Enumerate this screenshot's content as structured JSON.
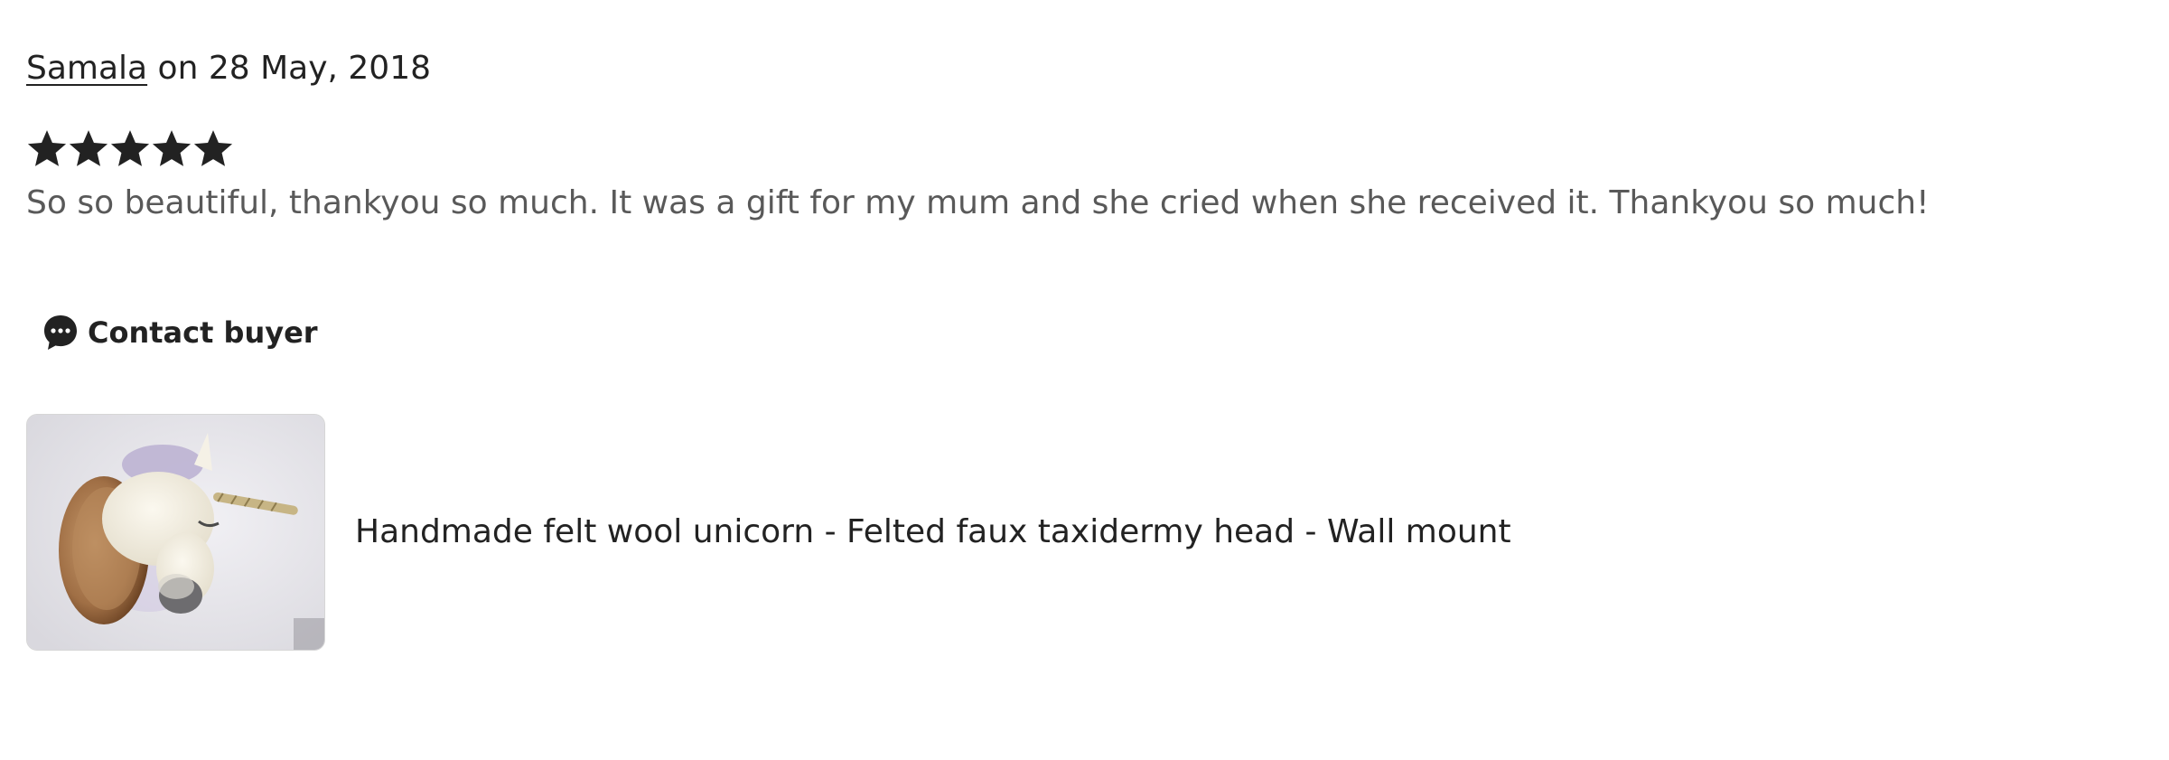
{
  "review": {
    "reviewer_name": "Samala",
    "date_text": " on 28 May, 2018",
    "rating": 5,
    "rating_max": 5,
    "text": "So so beautiful, thankyou so much. It was a gift for my mum and she cried when she received it. Thankyou so much!"
  },
  "contact": {
    "icon": "speech-bubble-dots-icon",
    "label": "Contact buyer"
  },
  "listing": {
    "title": "Handmade felt wool unicorn - Felted faux taxidermy head - Wall mount"
  },
  "colors": {
    "text_primary": "#222222",
    "text_secondary": "#595959",
    "star": "#222222"
  }
}
